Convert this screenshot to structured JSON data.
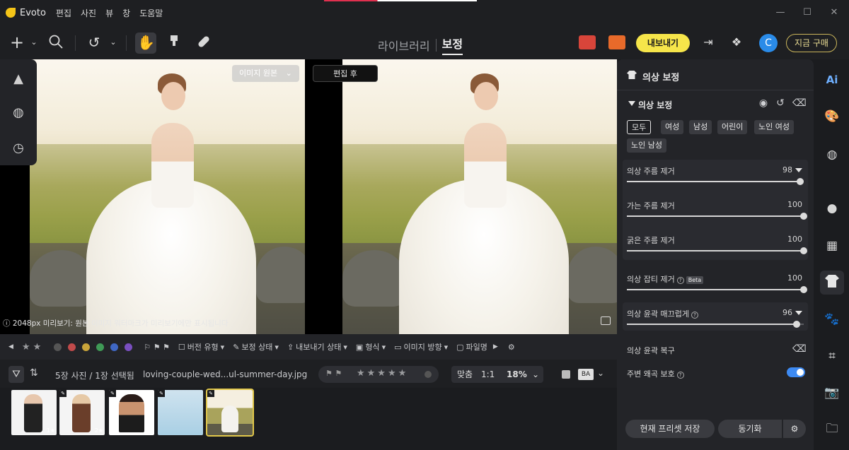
{
  "app": {
    "name": "Evoto",
    "menu": [
      "편집",
      "사진",
      "뷰",
      "창",
      "도움말"
    ],
    "window_controls": [
      "—",
      "☐",
      "✕"
    ]
  },
  "toolbar": {
    "mode_tabs": [
      {
        "label": "라이브러리",
        "active": false
      },
      {
        "label": "보정",
        "active": true
      }
    ],
    "export_label": "내보내기",
    "avatar_letter": "C",
    "buy_label": "지금 구매",
    "accent_color": "#f6e54a"
  },
  "canvas": {
    "before_label": "이미지 원본",
    "after_label": "편집 후",
    "info_text": "2048px 미리보기: 원본 이미지 워터마크가 미리보기에만 표시됩니다"
  },
  "filterbar": {
    "version_type": "버전 유형",
    "edit_status": "보정 상태",
    "export_status": "내보내기 상태",
    "format": "형식",
    "orientation": "이미지 방향",
    "file": "파일명"
  },
  "strip": {
    "count_text": "5장 사진 / 1장 선택됨",
    "filename": "loving-couple-wed...ul-summer-day.jpg",
    "zoom_fit": "맞춤",
    "zoom_1to1": "1:1",
    "zoom_value": "18%",
    "ba_label": "BA"
  },
  "panel": {
    "header_title": "의상 보정",
    "section_title": "의상 보정",
    "chips": [
      {
        "label": "모두",
        "active": true
      },
      {
        "label": "여성",
        "active": false
      },
      {
        "label": "남성",
        "active": false
      },
      {
        "label": "어린이",
        "active": false
      },
      {
        "label": "노인 여성",
        "active": false
      },
      {
        "label": "노인 남성",
        "active": false
      }
    ],
    "sliders": {
      "wrinkle": {
        "label": "의상 주름 제거",
        "value": "98",
        "fraction": 0.98
      },
      "fine": {
        "label": "가는 주름 제거",
        "value": "100",
        "fraction": 1.0
      },
      "thick": {
        "label": "굵은 주름 제거",
        "value": "100",
        "fraction": 1.0
      },
      "lint": {
        "label": "의상 잡티 제거",
        "value": "100",
        "fraction": 1.0,
        "badge": "Beta"
      },
      "smooth": {
        "label": "의상 윤곽 매끄럽게",
        "value": "96",
        "fraction": 0.96
      }
    },
    "restore_label": "의상 윤곽 복구",
    "protect_label": "주변 왜곡 보호",
    "save_preset": "현재 프리셋 저장",
    "sync": "동기화",
    "toggle_color": "#3d8af2"
  },
  "icons": {
    "right_rail": [
      "ai-icon",
      "palette-icon",
      "texture-icon",
      "head-icon",
      "background-icon",
      "shirt-icon",
      "paw-icon",
      "crop-icon",
      "camera-icon",
      "folder-icon"
    ]
  }
}
